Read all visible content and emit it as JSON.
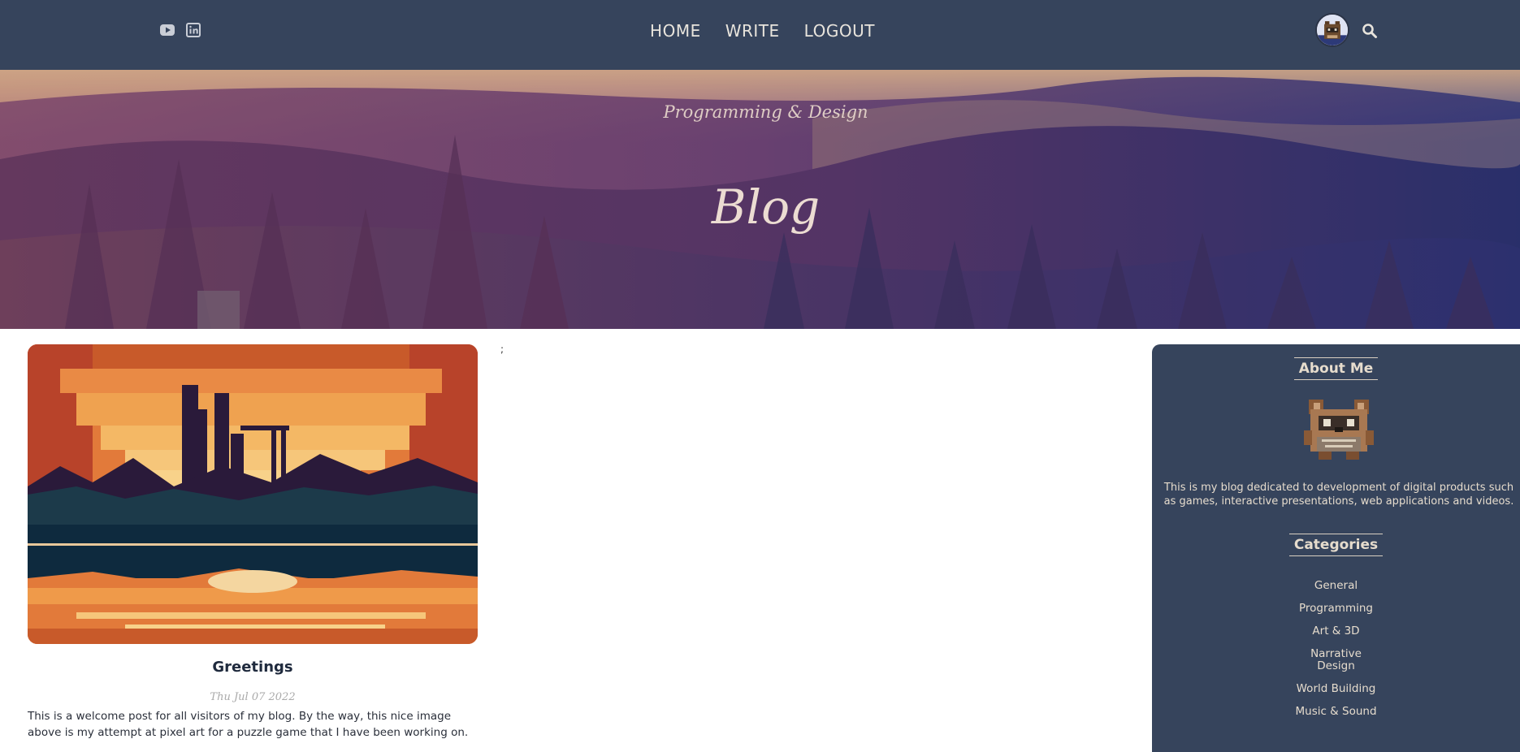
{
  "nav": {
    "social": [
      {
        "icon": "youtube-icon"
      },
      {
        "icon": "linkedin-icon"
      }
    ],
    "links": [
      "HOME",
      "WRITE",
      "LOGOUT"
    ],
    "avatar_icon": "avatar",
    "search_icon": "search-icon"
  },
  "hero": {
    "subtitle": "Programming & Design",
    "title": "Blog"
  },
  "post": {
    "title": "Greetings",
    "date": "Thu Jul 07 2022",
    "excerpt": "This is a welcome post for all visitors of my blog. By the way, this nice image above is my attempt at pixel art for a puzzle game that I have been working on."
  },
  "stray_text": ";",
  "sidebar": {
    "about_heading": "About Me",
    "about_text": "This is my blog dedicated to development of digital products such as games, interactive presentations, web applications and videos.",
    "categories_heading": "Categories",
    "categories": [
      "General",
      "Programming",
      "Art & 3D",
      "Narrative Design",
      "World Building",
      "Music & Sound"
    ]
  },
  "colors": {
    "nav_bg": "#36445c",
    "sidebar_bg": "#36445c",
    "nav_text": "#e8e4dc",
    "post_title": "#1f2a3d"
  }
}
